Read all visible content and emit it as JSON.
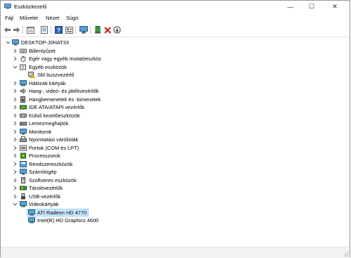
{
  "window": {
    "title": "Eszközkezelő",
    "controls": {
      "minimize": "—",
      "maximize": "☐",
      "close": "✕"
    }
  },
  "menu": [
    "Fájl",
    "Művelet",
    "Nézet",
    "Súgó"
  ],
  "toolbar": [
    "back-arrow-icon",
    "forward-arrow-icon",
    "device-view-icon",
    "properties-icon",
    "help-icon",
    "resources-icon",
    "monitor-scan-icon",
    "add-driver-icon",
    "uninstall-icon",
    "disable-icon"
  ],
  "tree": {
    "root": "DESKTOP-J0HAT33",
    "items": [
      {
        "label": "Billentyűzet",
        "icon": "keyboard-icon",
        "expanded": false
      },
      {
        "label": "Egér vagy egyéb mutatóeszköz",
        "icon": "mouse-icon",
        "expanded": false
      },
      {
        "label": "Egyéb eszközök",
        "icon": "other-devices-icon",
        "expanded": true
      },
      {
        "label": "SM buszvezérlő",
        "icon": "warning-device-icon",
        "child": true
      },
      {
        "label": "Hálózati kártyák",
        "icon": "network-icon",
        "expanded": false
      },
      {
        "label": "Hang-, videó- és játékvezérlők",
        "icon": "sound-icon",
        "expanded": false
      },
      {
        "label": "Hangbemenetek és -kimenetek",
        "icon": "speaker-icon",
        "expanded": false
      },
      {
        "label": "IDE ATA/ATAPI vezérlők",
        "icon": "ide-icon",
        "expanded": false
      },
      {
        "label": "Külső kezelőeszközök",
        "icon": "hid-icon",
        "expanded": false
      },
      {
        "label": "Lemezmeghajtók",
        "icon": "disk-icon",
        "expanded": false
      },
      {
        "label": "Monitorok",
        "icon": "monitor-icon",
        "expanded": false
      },
      {
        "label": "Nyomtatási várólisták",
        "icon": "printer-icon",
        "expanded": false
      },
      {
        "label": "Portok (COM és LPT)",
        "icon": "port-icon",
        "expanded": false
      },
      {
        "label": "Processzorok",
        "icon": "processor-icon",
        "expanded": false
      },
      {
        "label": "Rendszereszközök",
        "icon": "system-icon",
        "expanded": false
      },
      {
        "label": "Számítógép",
        "icon": "computer-icon",
        "expanded": false
      },
      {
        "label": "Szoftveres eszközök",
        "icon": "software-device-icon",
        "expanded": false
      },
      {
        "label": "Tárolóvezérlők",
        "icon": "storage-icon",
        "expanded": false
      },
      {
        "label": "USB-vezérlők",
        "icon": "usb-icon",
        "expanded": false
      },
      {
        "label": "Videokártyák",
        "icon": "display-adapter-icon",
        "expanded": true
      },
      {
        "label": "ATI Radeon HD 4770",
        "icon": "display-adapter-icon",
        "child": true,
        "selected": true
      },
      {
        "label": "Intel(R) HD Graphics 4600",
        "icon": "display-adapter-icon",
        "child": true
      }
    ]
  },
  "colors": {
    "selection": "#cce8ff",
    "selection_border": "#99d1ff",
    "accent": "#0078d7"
  }
}
